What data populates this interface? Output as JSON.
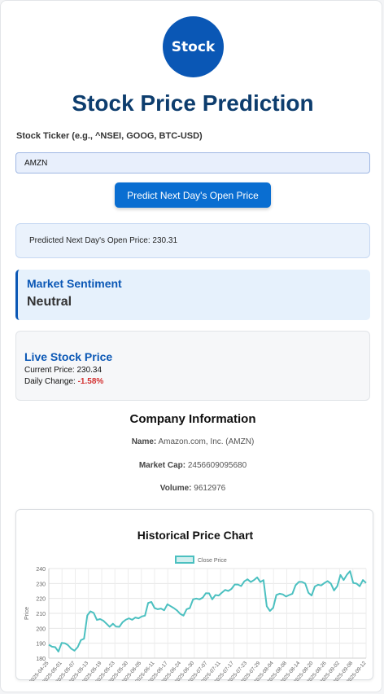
{
  "logo": {
    "text": "Stock"
  },
  "page": {
    "title": "Stock Price Prediction"
  },
  "form": {
    "ticker_label": "Stock Ticker (e.g., ^NSEI, GOOG, BTC-USD)",
    "ticker_value": "AMZN",
    "predict_button": "Predict Next Day's Open Price"
  },
  "prediction": {
    "text": "Predicted Next Day's Open Price: 230.31"
  },
  "sentiment": {
    "title": "Market Sentiment",
    "value": "Neutral"
  },
  "live": {
    "title": "Live Stock Price",
    "current_label": "Current Price:",
    "current_value": "230.34",
    "change_label": "Daily Change:",
    "change_value": "-1.58%"
  },
  "company": {
    "title": "Company Information",
    "name_label": "Name:",
    "name_value": "Amazon.com, Inc. (AMZN)",
    "cap_label": "Market Cap:",
    "cap_value": "2456609095680",
    "volume_label": "Volume:",
    "volume_value": "9612976"
  },
  "colors": {
    "accent": "#0a57b5",
    "button": "#0a6ed1",
    "negative": "#d32f2f",
    "series_line": "#4bc0c0"
  },
  "chart_data": {
    "type": "line",
    "title": "Historical Price Chart",
    "xlabel": "",
    "ylabel": "Price",
    "legend_position": "top",
    "grid": true,
    "ylim": [
      180,
      240
    ],
    "y_ticks": [
      180,
      190,
      200,
      210,
      220,
      230,
      240
    ],
    "x_ticks": [
      "2025-04-25",
      "2025-05-01",
      "2025-05-07",
      "2025-05-13",
      "2025-05-19",
      "2025-05-23",
      "2025-05-30",
      "2025-06-05",
      "2025-06-11",
      "2025-06-17",
      "2025-06-24",
      "2025-06-30",
      "2025-07-07",
      "2025-07-11",
      "2025-07-17",
      "2025-07-23",
      "2025-07-29",
      "2025-08-04",
      "2025-08-08",
      "2025-08-14",
      "2025-08-20",
      "2025-08-26",
      "2025-09-02",
      "2025-09-08",
      "2025-09-12"
    ],
    "series": [
      {
        "name": "Close Price",
        "values": [
          188.99,
          187.7,
          187.39,
          184.42,
          190.2,
          189.98,
          188.71,
          186.35,
          185.01,
          187.39,
          192.08,
          193.06,
          208.64,
          211.37,
          210.25,
          205.59,
          206.16,
          205.07,
          203.1,
          200.99,
          203.1,
          201.12,
          200.99,
          204.07,
          205.7,
          206.65,
          205.71,
          207.23,
          206.65,
          207.91,
          208.47,
          216.98,
          217.61,
          213.57,
          212.77,
          213.24,
          212.1,
          216.1,
          214.82,
          213.57,
          211.99,
          209.69,
          208.47,
          212.77,
          213.57,
          219.39,
          219.92,
          219.36,
          220.46,
          223.47,
          223.41,
          219.36,
          222.26,
          221.95,
          223.88,
          225.69,
          225.02,
          226.35,
          229.3,
          229.3,
          228.29,
          231.44,
          232.79,
          231.01,
          232.23,
          234.11,
          231.01,
          232.23,
          214.75,
          211.65,
          213.75,
          222.31,
          223.13,
          222.69,
          221.3,
          222.26,
          223.13,
          228.84,
          231.03,
          231.03,
          229.95,
          223.81,
          221.95,
          228.01,
          229.12,
          228.7,
          230.33,
          231.6,
          229.95,
          225.34,
          228.15,
          235.68,
          232.33,
          235.84,
          238.24,
          230.33,
          229.95,
          228.15,
          232.33,
          230.34
        ]
      }
    ]
  }
}
